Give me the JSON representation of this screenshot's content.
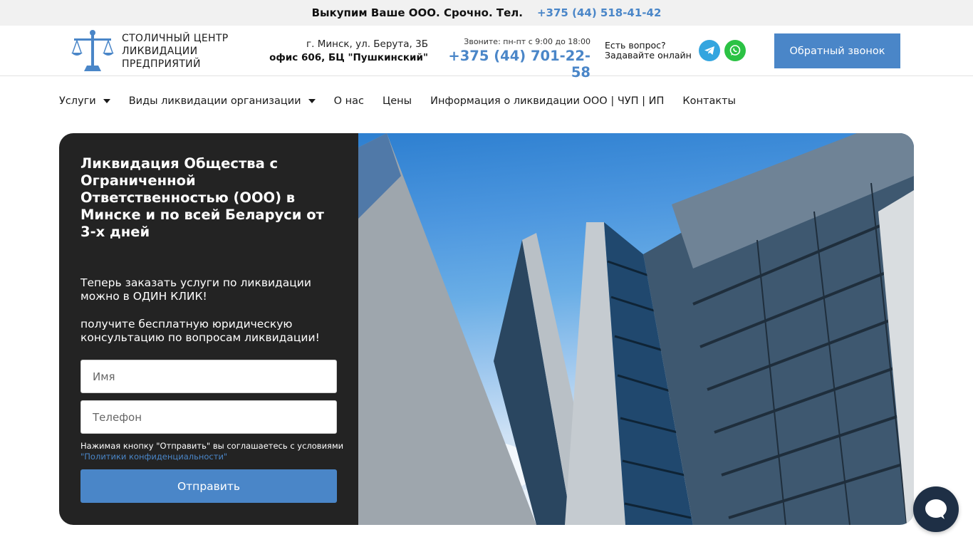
{
  "topbar": {
    "text": "Выкупим Ваше ООО. Срочно. Тел.",
    "phone": "+375 (44) 518-41-42"
  },
  "header": {
    "logo_lines": [
      "СТОЛИЧНЫЙ ЦЕНТР",
      "ЛИКВИДАЦИИ",
      "ПРЕДПРИЯТИЙ"
    ],
    "address_line1": "г. Минск, ул. Берута, 3Б",
    "address_line2": "офис 606, БЦ \"Пушкинский\"",
    "hours": "Звоните: пн-пт с 9:00 до 18:00",
    "phone": "+375 (44) 701-22-58",
    "question_line1": "Есть вопрос?",
    "question_line2": "Задавайте онлайн",
    "callback_label": "Обратный звонок"
  },
  "nav": {
    "items": [
      {
        "label": "Услуги",
        "dropdown": true
      },
      {
        "label": "Виды ликвидации организации",
        "dropdown": true
      },
      {
        "label": "О нас",
        "dropdown": false
      },
      {
        "label": "Цены",
        "dropdown": false
      },
      {
        "label": "Информация о ликвидации ООО | ЧУП | ИП",
        "dropdown": false
      },
      {
        "label": "Контакты",
        "dropdown": false
      }
    ]
  },
  "hero": {
    "title": "Ликвидация Общества с Ограниченной Ответственностью (ООО) в Минске и по всей Беларуси от 3-х дней",
    "subtitle1": "Теперь заказать услуги по ликвидации можно в ОДИН КЛИК!",
    "subtitle2": "получите бесплатную юридическую консультацию по вопросам ликвидации!",
    "name_placeholder": "Имя",
    "phone_placeholder": "Телефон",
    "agree_text": "Нажимая кнопку \"Отправить\" вы соглашаетесь с условиями",
    "agree_link": "\"Политики конфиденциальности\"",
    "submit_label": "Отправить"
  },
  "icons": {
    "logo": "scales-of-justice-icon",
    "telegram": "telegram-icon",
    "whatsapp": "whatsapp-icon",
    "chat": "chat-bubble-icon"
  },
  "colors": {
    "accent": "#4a86c8",
    "panel": "#232323",
    "telegram": "#34a5df",
    "whatsapp": "#2bc244",
    "chat": "#1e2f45"
  }
}
